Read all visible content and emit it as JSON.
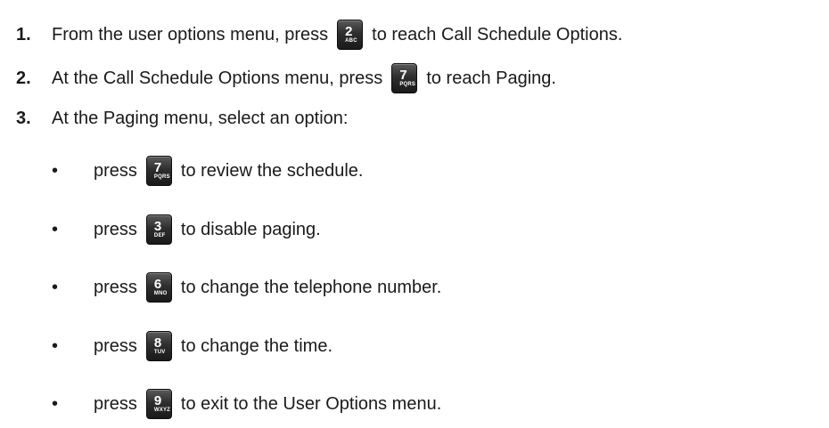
{
  "steps": [
    {
      "num": "1.",
      "before": "From the user options menu, press",
      "key": {
        "digit": "2",
        "letters": "ABC"
      },
      "after": "to reach Call Schedule Options."
    },
    {
      "num": "2.",
      "before": "At the Call Schedule Options menu, press",
      "key": {
        "digit": "7",
        "letters": "PQRS"
      },
      "after": "to reach Paging."
    },
    {
      "num": "3.",
      "text": "At the Paging menu, select an option:"
    }
  ],
  "options": [
    {
      "bullet": "•",
      "before": "press",
      "key": {
        "digit": "7",
        "letters": "PQRS"
      },
      "after": "to review the schedule."
    },
    {
      "bullet": "•",
      "before": "press",
      "key": {
        "digit": "3",
        "letters": "DEF"
      },
      "after": "to disable paging."
    },
    {
      "bullet": "•",
      "before": "press",
      "key": {
        "digit": "6",
        "letters": "MNO"
      },
      "after": "to change the telephone number."
    },
    {
      "bullet": "•",
      "before": "press",
      "key": {
        "digit": "8",
        "letters": "TUV"
      },
      "after": "to change the time."
    },
    {
      "bullet": "•",
      "before": "press",
      "key": {
        "digit": "9",
        "letters": "WXYZ"
      },
      "after": "to exit to the User Options menu."
    }
  ]
}
